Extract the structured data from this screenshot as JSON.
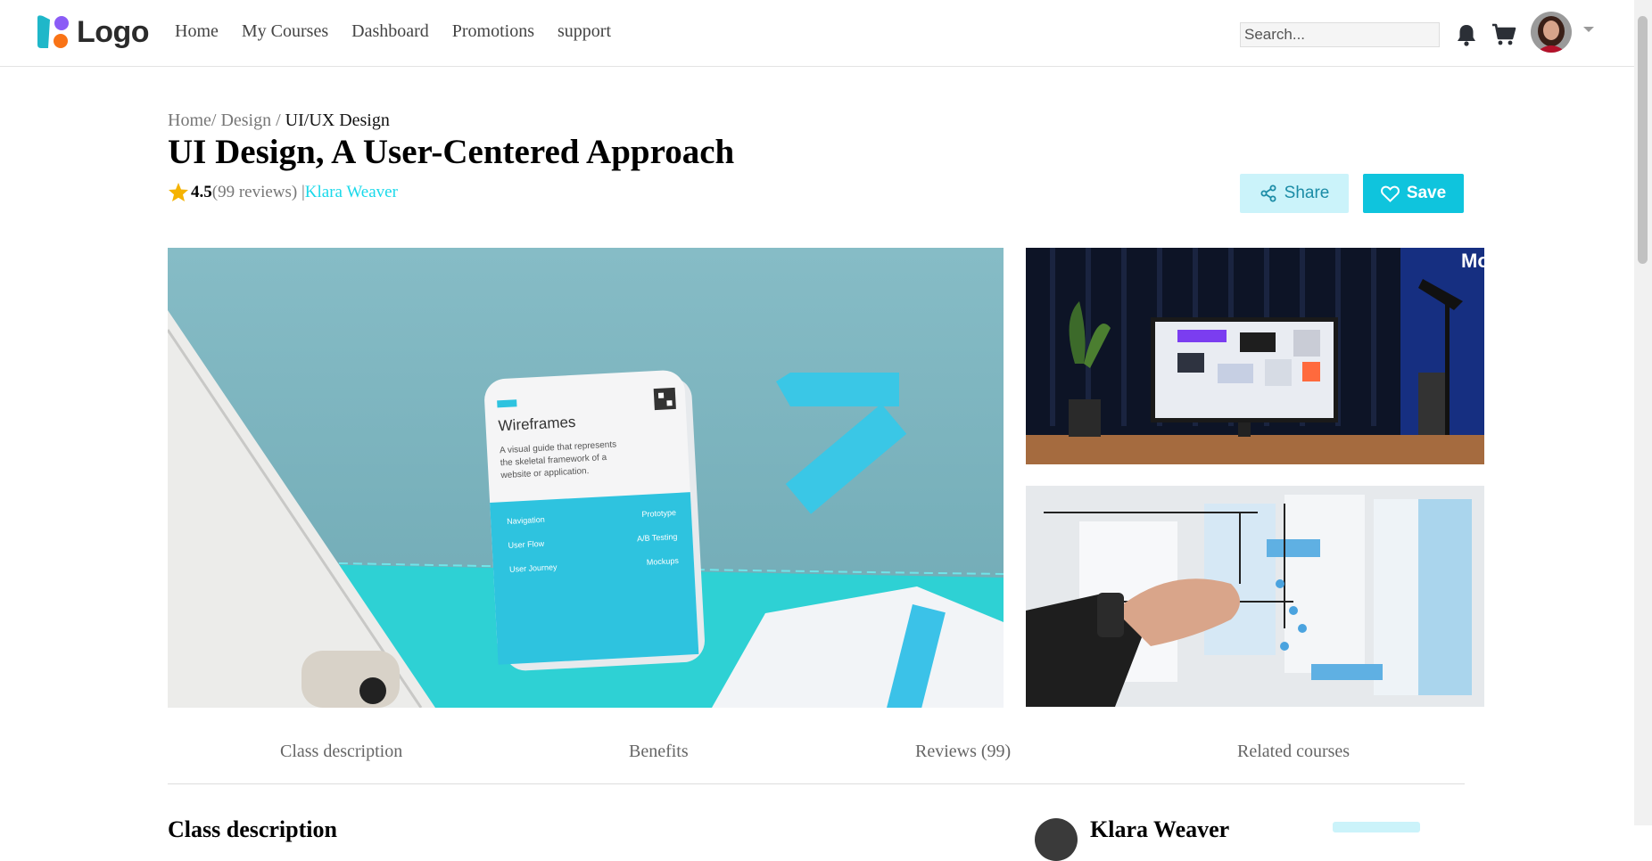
{
  "header": {
    "logo_text": "Logo",
    "nav": [
      {
        "label": "Home"
      },
      {
        "label": "My Courses"
      },
      {
        "label": "Dashboard"
      },
      {
        "label": "Promotions"
      },
      {
        "label": "support"
      }
    ],
    "search_placeholder": "Search...",
    "icons": [
      "bell-icon",
      "cart-icon",
      "chevron-down-icon"
    ]
  },
  "breadcrumb": {
    "home": "Home/",
    "design": "Design /",
    "current": "UI/UX Design"
  },
  "course": {
    "title": "UI Design, A User-Centered Approach",
    "rating": "4.5",
    "reviews": "(99 reviews) |",
    "author": "Klara Weaver"
  },
  "actions": {
    "share_label": "Share",
    "save_label": "Save"
  },
  "gallery": {
    "card_title": "Wireframes",
    "card_desc": [
      "A visual guide that represents",
      "the skeletal framework of a",
      "website or application."
    ],
    "card_items_left": [
      "Navigation",
      "User Flow",
      "User Journey"
    ],
    "card_items_right": [
      "Prototype",
      "A/B Testing",
      "Mockups"
    ]
  },
  "tabs": [
    {
      "label": "Class description"
    },
    {
      "label": "Benefits"
    },
    {
      "label": "Reviews (99)"
    },
    {
      "label": "Related courses"
    }
  ],
  "below": {
    "section_title": "Class description",
    "author_name": "Klara Weaver"
  },
  "colors": {
    "accent": "#0fc4dd",
    "accent_light": "#cbf3fa",
    "author_link": "#1ad9ea",
    "star": "#f5b301"
  }
}
